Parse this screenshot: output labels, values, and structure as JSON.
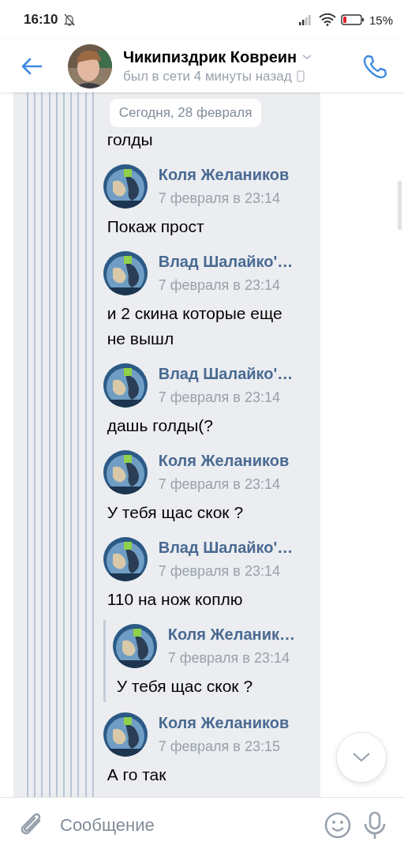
{
  "status_bar": {
    "time": "16:10",
    "battery": "15%"
  },
  "header": {
    "name": "Чикипиздрик Ковреин",
    "status": "был в сети 4 минуты назад"
  },
  "chat": {
    "date_label": "Сегодня, 28 февраля",
    "messages": [
      {
        "kind": "text",
        "text": "голды"
      },
      {
        "kind": "post",
        "author": "Коля Желаников",
        "time": "7 февраля в 23:14",
        "quoted": false,
        "text": "Покаж прост"
      },
      {
        "kind": "post",
        "author": "Влад Шалайко'…",
        "time": "7 февраля в 23:14",
        "quoted": false,
        "text": "и 2 скина которые еще не вышл"
      },
      {
        "kind": "post",
        "author": "Влад Шалайко'…",
        "time": "7 февраля в 23:14",
        "quoted": false,
        "text": "дашь голды(?"
      },
      {
        "kind": "post",
        "author": "Коля Желаников",
        "time": "7 февраля в 23:14",
        "quoted": false,
        "text": "У тебя щас скок ?"
      },
      {
        "kind": "post",
        "author": "Влад Шалайко'…",
        "time": "7 февраля в 23:14",
        "quoted": false,
        "text": "110 на нож коплю"
      },
      {
        "kind": "post",
        "author": "Коля Желаник…",
        "time": "7 февраля в 23:14",
        "quoted": true,
        "text": "У тебя щас скок ?"
      },
      {
        "kind": "post",
        "author": "Коля Желаников",
        "time": "7 февраля в 23:15",
        "quoted": false,
        "text": "А го так"
      }
    ]
  },
  "composer": {
    "placeholder": "Сообщение"
  }
}
